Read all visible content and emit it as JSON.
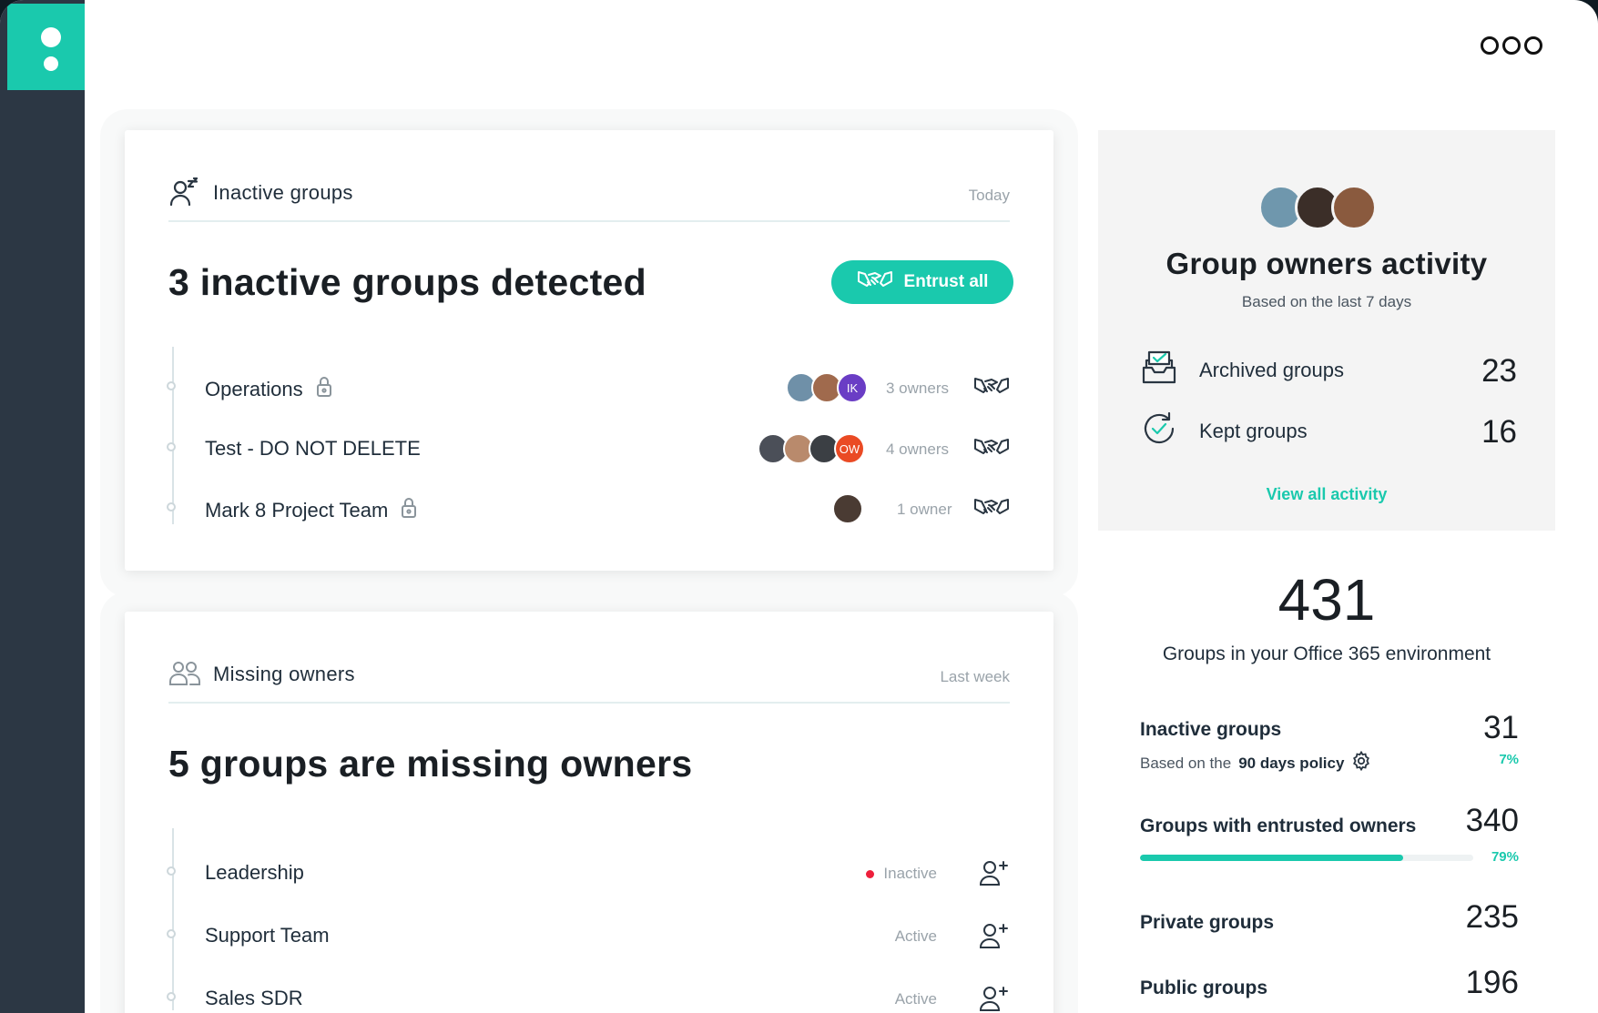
{
  "app": {
    "brand_color": "#1ac9ad",
    "menu_icon": "more-icon"
  },
  "inactive_card": {
    "title": "Inactive groups",
    "when": "Today",
    "headline": "3 inactive groups detected",
    "entrust_all_label": "Entrust all",
    "groups": [
      {
        "name": "Operations",
        "private": true,
        "owners_text": "3 owners",
        "avatars": [
          {
            "kind": "photo",
            "color": "#6f90a8"
          },
          {
            "kind": "photo",
            "color": "#a06a4d"
          },
          {
            "kind": "initials",
            "text": "IK",
            "color": "#6a3dc5"
          }
        ]
      },
      {
        "name": "Test - DO NOT DELETE",
        "private": false,
        "owners_text": "4 owners",
        "avatars": [
          {
            "kind": "photo",
            "color": "#4b4f58"
          },
          {
            "kind": "photo",
            "color": "#b98a6c"
          },
          {
            "kind": "photo",
            "color": "#3b3f44"
          },
          {
            "kind": "initials",
            "text": "OW",
            "color": "#ea4a24"
          }
        ]
      },
      {
        "name": "Mark 8 Project Team",
        "private": true,
        "owners_text": "1 owner",
        "avatars": [
          {
            "kind": "photo",
            "color": "#4a3b33"
          }
        ]
      }
    ]
  },
  "missing_card": {
    "title": "Missing owners",
    "when": "Last week",
    "headline": "5 groups are missing owners",
    "groups": [
      {
        "name": "Leadership",
        "status": "Inactive"
      },
      {
        "name": "Support Team",
        "status": "Active"
      },
      {
        "name": "Sales SDR",
        "status": "Active"
      }
    ]
  },
  "activity": {
    "title": "Group owners activity",
    "subtitle": "Based on the last 7 days",
    "rows": [
      {
        "label": "Archived groups",
        "value": "23",
        "icon": "archive-icon"
      },
      {
        "label": "Kept groups",
        "value": "16",
        "icon": "check-circle-icon"
      }
    ],
    "link": "View all activity"
  },
  "totals": {
    "count": "431",
    "caption": "Groups in your Office 365 environment",
    "inactive": {
      "label": "Inactive groups",
      "value": "31",
      "pct": "7%",
      "sub_prefix": "Based on the",
      "sub_policy": "90 days policy"
    },
    "entrusted": {
      "label": "Groups with entrusted owners",
      "value": "340",
      "pct": "79%",
      "progress": 0.79
    },
    "private": {
      "label": "Private groups",
      "value": "235"
    },
    "public": {
      "label": "Public groups",
      "value": "196"
    }
  }
}
